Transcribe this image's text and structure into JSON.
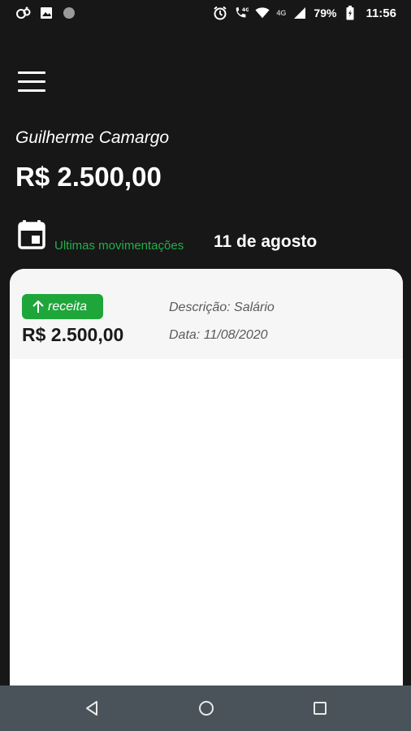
{
  "status_bar": {
    "battery": "79%",
    "time": "11:56",
    "network": "4G",
    "icons": [
      "notification-app-icon",
      "image-icon",
      "circle-icon",
      "alarm-icon",
      "call-4g-icon",
      "wifi-icon",
      "signal-icon",
      "battery-icon"
    ]
  },
  "user": {
    "name": "Guilherme Camargo",
    "balance": "R$ 2.500,00"
  },
  "section": {
    "label": "Ultimas movimentações",
    "date": "11 de agosto"
  },
  "transactions": [
    {
      "type": "receita",
      "amount": "R$ 2.500,00",
      "description": "Descrição: Salário",
      "date": "Data: 11/08/2020"
    }
  ],
  "colors": {
    "background": "#171717",
    "accent_green": "#22b04a",
    "badge_green": "#1ea63a",
    "card": "#ffffff",
    "row": "#f6f6f6",
    "nav_bar": "#4a535a"
  },
  "nav": {
    "icons": [
      "back-icon",
      "home-icon",
      "recents-icon"
    ]
  }
}
